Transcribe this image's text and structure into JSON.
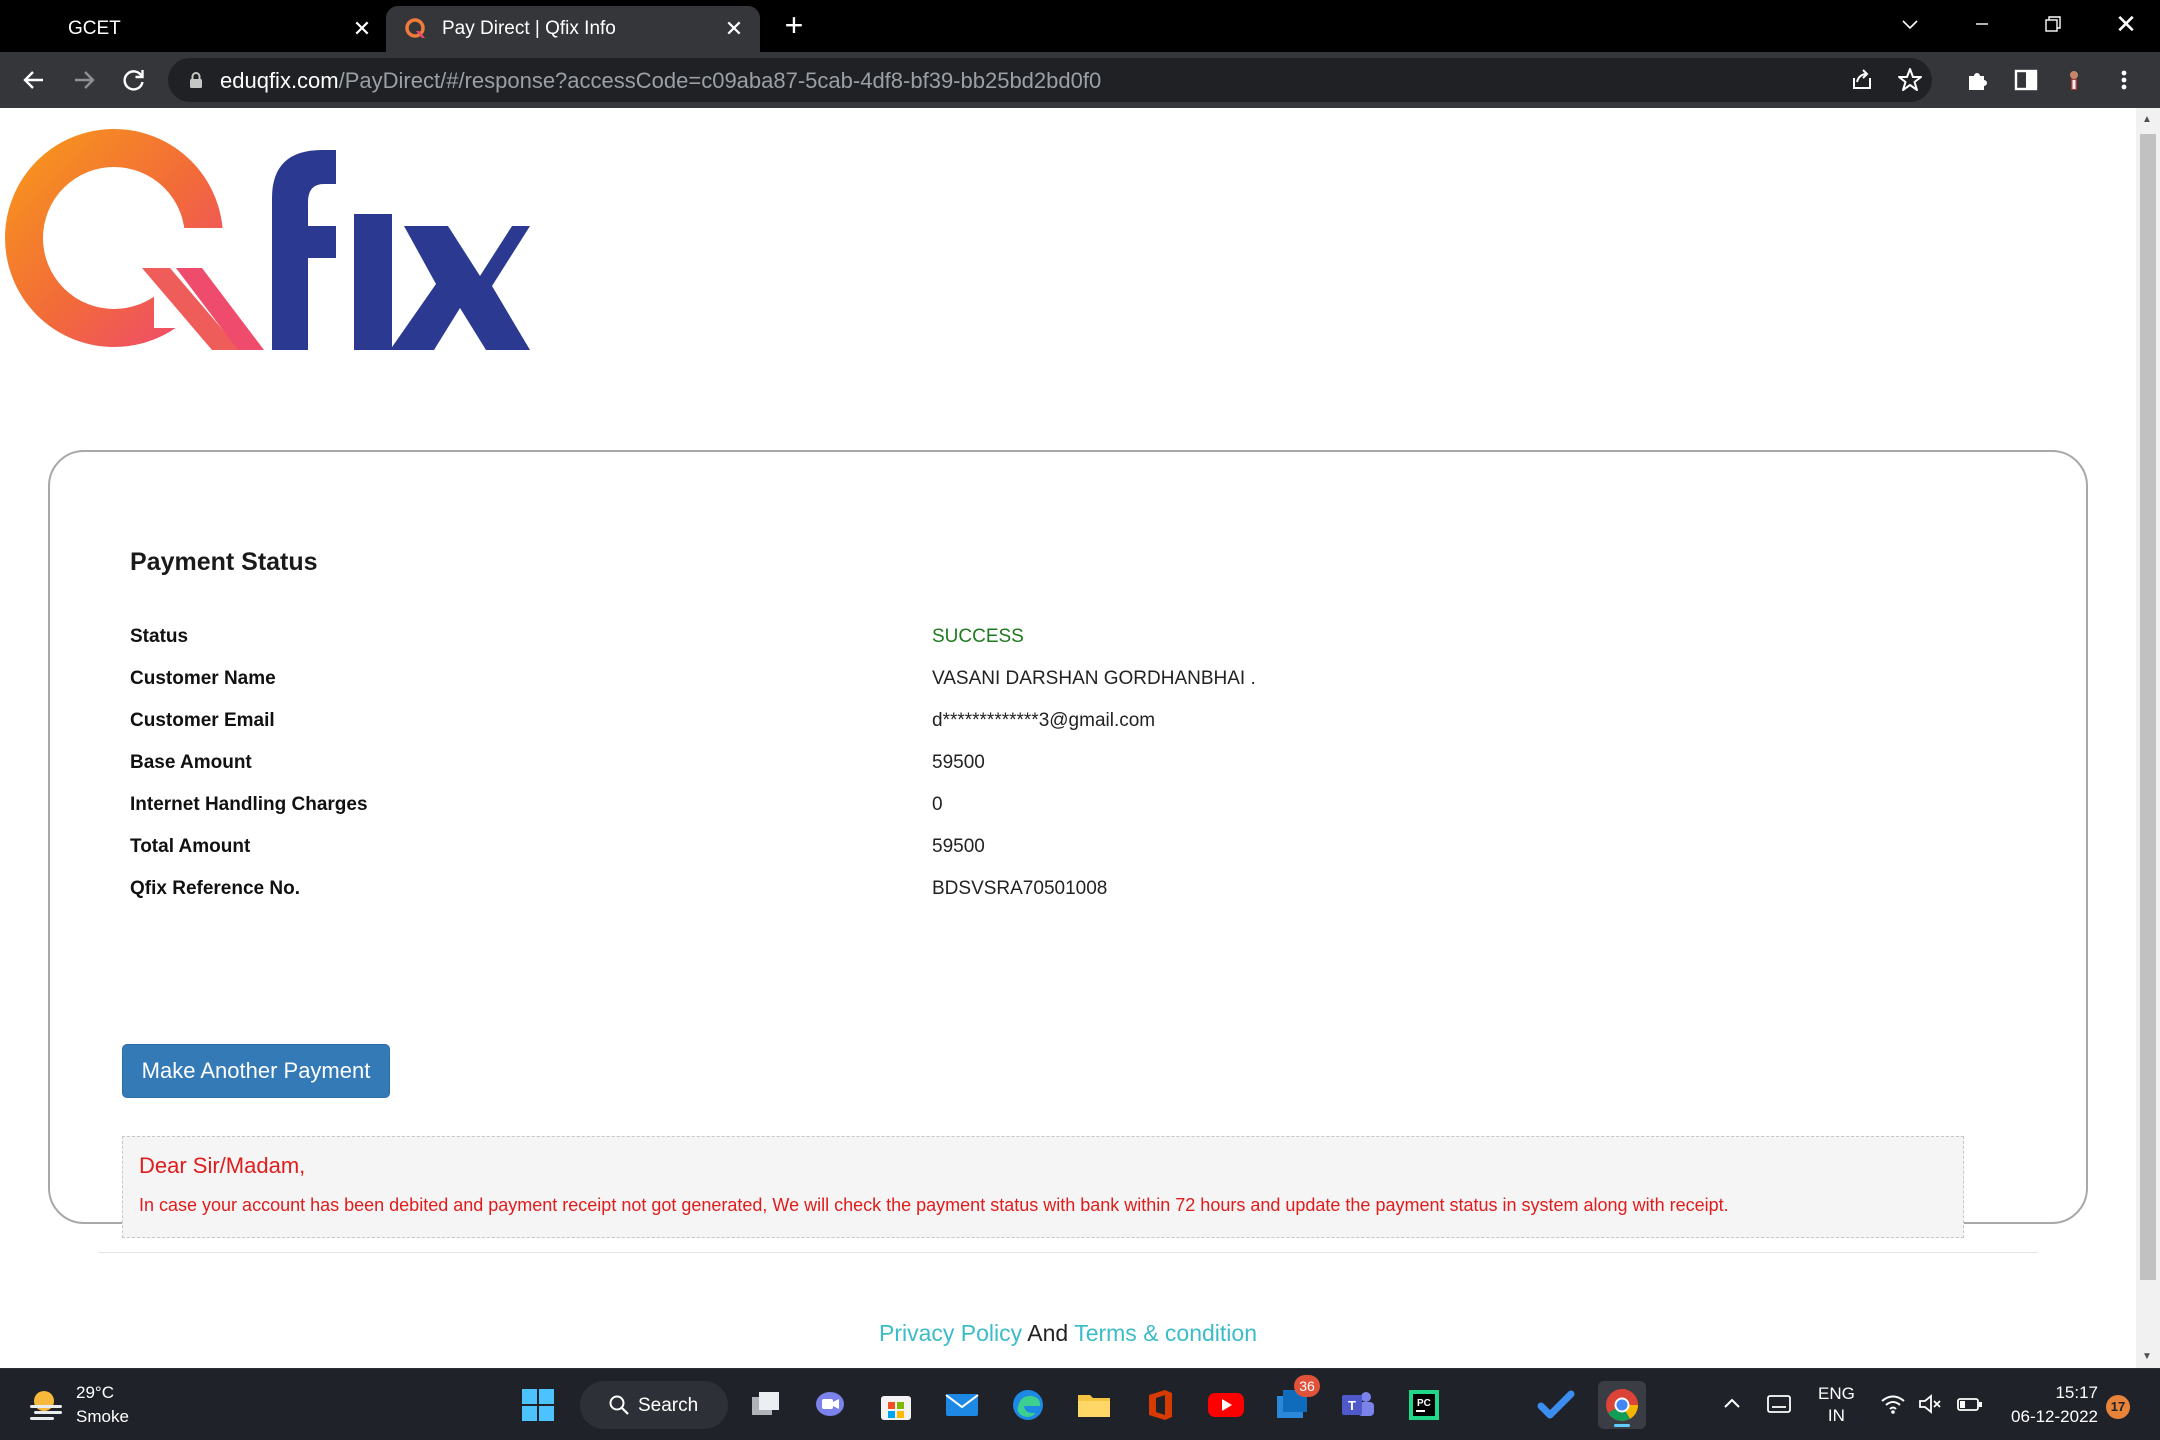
{
  "browser": {
    "tabs": [
      {
        "title": "GCET",
        "active": false
      },
      {
        "title": "Pay Direct | Qfix Info",
        "active": true
      }
    ],
    "url_host": "eduqfix.com",
    "url_path": "/PayDirect/#/response?accessCode=c09aba87-5cab-4df8-bf39-bb25bd2bd0f0"
  },
  "logo": {
    "brand": "Qfix",
    "colors": {
      "orange": "#f7941d",
      "pink": "#ef4b6c",
      "navy": "#2b3990"
    }
  },
  "payment": {
    "heading": "Payment Status",
    "rows": [
      {
        "label": "Status",
        "value": "SUCCESS"
      },
      {
        "label": "Customer Name",
        "value": "VASANI DARSHAN GORDHANBHAI ."
      },
      {
        "label": "Customer Email",
        "value": "d*************3@gmail.com"
      },
      {
        "label": "Base Amount",
        "value": "59500"
      },
      {
        "label": "Internet Handling Charges",
        "value": "0"
      },
      {
        "label": "Total Amount",
        "value": "59500"
      },
      {
        "label": "Qfix Reference No.",
        "value": "BDSVSRA70501008"
      }
    ],
    "button_label": "Make Another Payment",
    "notice": {
      "greeting": "Dear Sir/Madam,",
      "text": "In case your account has been debited and payment receipt not got generated, We will check the payment status with bank within 72 hours and update the payment status in system along with receipt."
    }
  },
  "footer": {
    "privacy": "Privacy Policy",
    "and": "And",
    "terms": "Terms & condition"
  },
  "taskbar": {
    "weather_temp": "29°C",
    "weather_cond": "Smoke",
    "search_label": "Search",
    "teams_badge": "36",
    "lang_line1": "ENG",
    "lang_line2": "IN",
    "time": "15:17",
    "date": "06-12-2022",
    "notif_count": "17"
  },
  "colors": {
    "success": "#1e7a1e",
    "notice_red": "#e01c1c",
    "link": "#3cbcc8",
    "button": "#337ab7"
  }
}
